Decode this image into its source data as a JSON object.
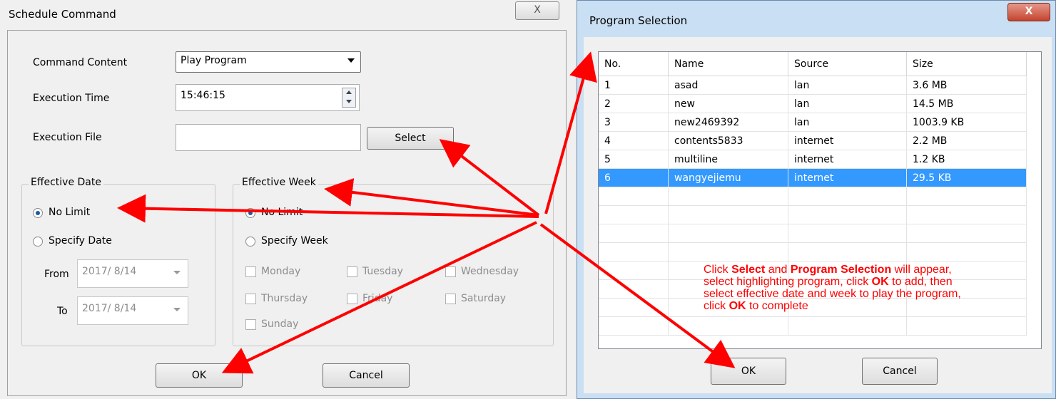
{
  "schedule_dialog": {
    "title": "Schedule Command",
    "close_glyph": "X",
    "command_content_label": "Command Content",
    "command_content_value": "Play Program",
    "execution_time_label": "Execution Time",
    "execution_time_value": "15:46:15",
    "execution_file_label": "Execution File",
    "execution_file_value": "",
    "select_button": "Select",
    "effective_date": {
      "title": "Effective Date",
      "no_limit": "No Limit",
      "specify_date": "Specify Date",
      "from_label": "From",
      "from_value": "2017/ 8/14",
      "to_label": "To",
      "to_value": "2017/ 8/14"
    },
    "effective_week": {
      "title": "Effective Week",
      "no_limit": "No Limit",
      "specify_week": "Specify Week",
      "days": [
        "Monday",
        "Tuesday",
        "Wednesday",
        "Thursday",
        "Friday",
        "Saturday",
        "Sunday"
      ]
    },
    "ok_button": "OK",
    "cancel_button": "Cancel"
  },
  "program_dialog": {
    "title": "Program Selection",
    "close_glyph": "X",
    "columns": [
      "No.",
      "Name",
      "Source",
      "Size"
    ],
    "rows": [
      [
        "1",
        "asad",
        "lan",
        "3.6 MB"
      ],
      [
        "2",
        "new",
        "lan",
        "14.5 MB"
      ],
      [
        "3",
        "new2469392",
        "lan",
        "1003.9 KB"
      ],
      [
        "4",
        "contents5833",
        "internet",
        "2.2 MB"
      ],
      [
        "5",
        "multiline",
        "internet",
        "1.2 KB"
      ],
      [
        "6",
        "wangyejiemu",
        "internet",
        "29.5 KB"
      ]
    ],
    "selected_row": 6,
    "ok_button": "OK",
    "cancel_button": "Cancel"
  },
  "annotation": {
    "line1_a": "Click ",
    "line1_b": "Select",
    "line1_c": " and ",
    "line1_d": "Program Selection",
    "line1_e": " will appear,",
    "line2_a": "select highlighting program, click ",
    "line2_b": "OK",
    "line2_c": " to add, then",
    "line3": "select effective date and week to play the program,",
    "line4_a": "click ",
    "line4_b": "OK",
    "line4_c": " to complete"
  },
  "colors": {
    "annotation": "#ff0000",
    "selection": "#3399ff"
  }
}
